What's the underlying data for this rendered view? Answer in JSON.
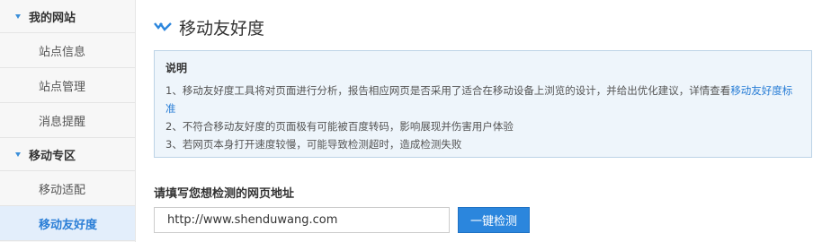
{
  "sidebar": {
    "groups": [
      {
        "label": "我的网站",
        "items": [
          {
            "label": "站点信息"
          },
          {
            "label": "站点管理"
          },
          {
            "label": "消息提醒"
          }
        ]
      },
      {
        "label": "移动专区",
        "items": [
          {
            "label": "移动适配"
          },
          {
            "label": "移动友好度"
          }
        ]
      }
    ],
    "active_item": "移动友好度"
  },
  "main": {
    "title": "移动友好度",
    "title_icon": "double-chevron-down-icon",
    "info": {
      "title": "说明",
      "line1_text": "1、移动友好度工具将对页面进行分析，报告相应网页是否采用了适合在移动设备上浏览的设计，并给出优化建议，详情查看",
      "line1_link": "移动友好度标准",
      "line2": "2、不符合移动友好度的页面极有可能被百度转码，影响展现并伤害用户体验",
      "line3": "3、若网页本身打开速度较慢，可能导致检测超时，造成检测失败"
    },
    "form": {
      "label": "请填写您想检测的网页地址",
      "url_value": "http://www.shenduwang.com",
      "button_label": "一键检测"
    }
  },
  "colors": {
    "accent": "#2b86dd",
    "link": "#2a7ed6",
    "active_bg": "#e3eefb",
    "info_bg": "#eef5fb"
  }
}
